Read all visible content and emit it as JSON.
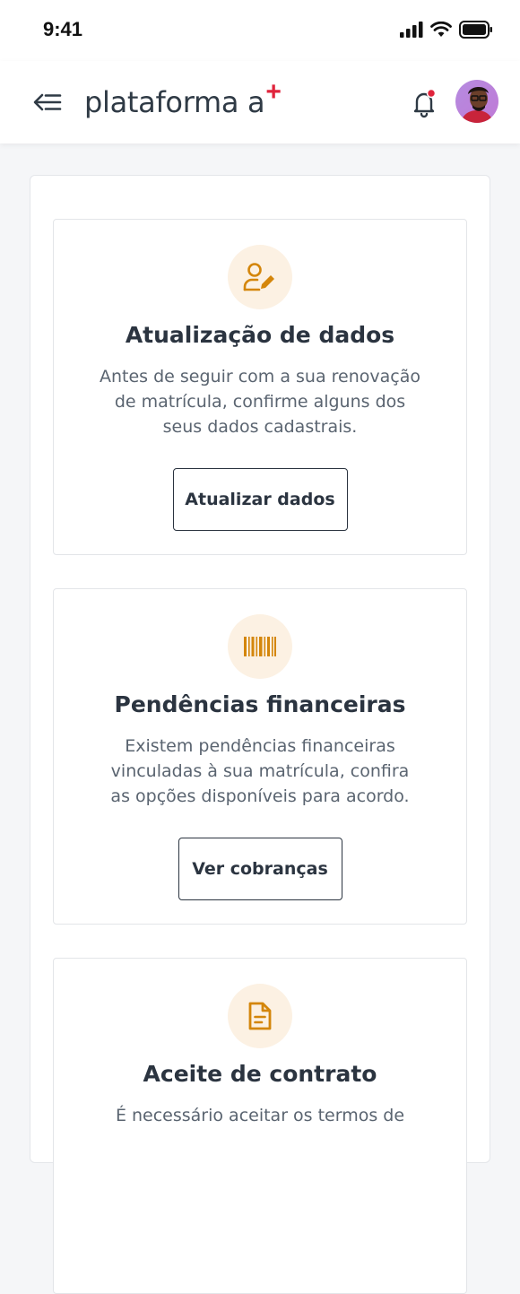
{
  "status_bar": {
    "time": "9:41"
  },
  "header": {
    "logo_text": "plataforma a",
    "logo_plus": "+"
  },
  "cards": [
    {
      "icon": "user-edit-icon",
      "title": "Atualização de dados",
      "description": "Antes de seguir com a sua renovação de matrícula, confirme alguns dos seus dados cadastrais.",
      "button": "Atualizar dados"
    },
    {
      "icon": "barcode-icon",
      "title": "Pendências financeiras",
      "description": "Existem pendências financeiras vinculadas à sua matrícula, confira as opções disponíveis para acordo.",
      "button": "Ver cobranças"
    },
    {
      "icon": "document-icon",
      "title": "Aceite de contrato",
      "description": "É necessário aceitar os termos de"
    }
  ],
  "colors": {
    "accent": "#d4860b",
    "icon_bg": "#fcf1e3",
    "brand_plus": "#e0243c",
    "notification_dot": "#e0243c"
  }
}
